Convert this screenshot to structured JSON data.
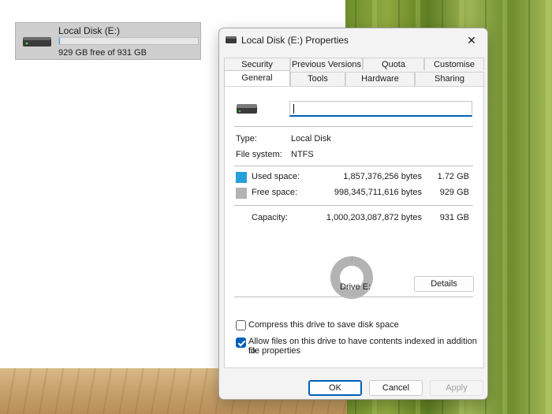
{
  "desktop": {
    "drive_tile": {
      "name": "Local Disk (E:)",
      "free_text": "929 GB free of 931 GB",
      "used_fraction": 0.002,
      "bar_color": "#26a0da",
      "icon": "drive-icon"
    }
  },
  "dialog": {
    "title": "Local Disk (E:) Properties",
    "close_label": "✕",
    "tabs_row1": [
      "Security",
      "Previous Versions",
      "Quota",
      "Customise"
    ],
    "tabs_row2": [
      "General",
      "Tools",
      "Hardware",
      "Sharing"
    ],
    "active_tab": "General",
    "general": {
      "name_value": "",
      "type_label": "Type:",
      "type_value": "Local Disk",
      "fs_label": "File system:",
      "fs_value": "NTFS",
      "used_label": "Used space:",
      "used_bytes": "1,857,376,256 bytes",
      "used_size": "1.72 GB",
      "free_label": "Free space:",
      "free_bytes": "998,345,711,616 bytes",
      "free_size": "929 GB",
      "capacity_label": "Capacity:",
      "capacity_bytes": "1,000,203,087,872 bytes",
      "capacity_size": "931 GB",
      "drive_caption": "Drive E:",
      "details_button": "Details",
      "compress_label": "Compress this drive to save disk space",
      "compress_checked": false,
      "index_label_line1": "Allow files on this drive to have contents indexed in addition to",
      "index_label_line2": "file properties",
      "index_checked": true,
      "used_fraction": 0.0019,
      "colors": {
        "used": "#26a0da",
        "free": "#b3b3b3",
        "accent": "#005fb8"
      }
    },
    "buttons": {
      "ok": "OK",
      "cancel": "Cancel",
      "apply": "Apply"
    }
  }
}
